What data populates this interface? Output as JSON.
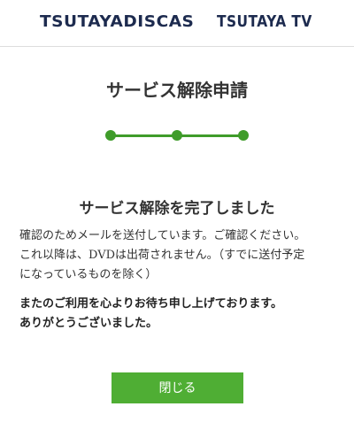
{
  "header": {
    "logo_discas": "TSUTAYADISCAS",
    "logo_tv": "TSUTAYA TV",
    "brand_color": "#1d2b4f"
  },
  "main": {
    "title": "サービス解除申請",
    "progress": {
      "steps_total": 3,
      "steps_completed": 3,
      "color": "#3f9c2a"
    },
    "done_title": "サービス解除を完了しました",
    "message_lines": [
      "確認のためメールを送付しています。ご確認ください。",
      "これ以降は、DVDは出荷されません。（すでに送付予定",
      "になっているものを除く）"
    ],
    "thanks_lines": [
      "またのご利用を心よりお待ち申し上げております。",
      "ありがとうございました。"
    ],
    "close_button_label": "閉じる",
    "button_color": "#4fae34"
  }
}
